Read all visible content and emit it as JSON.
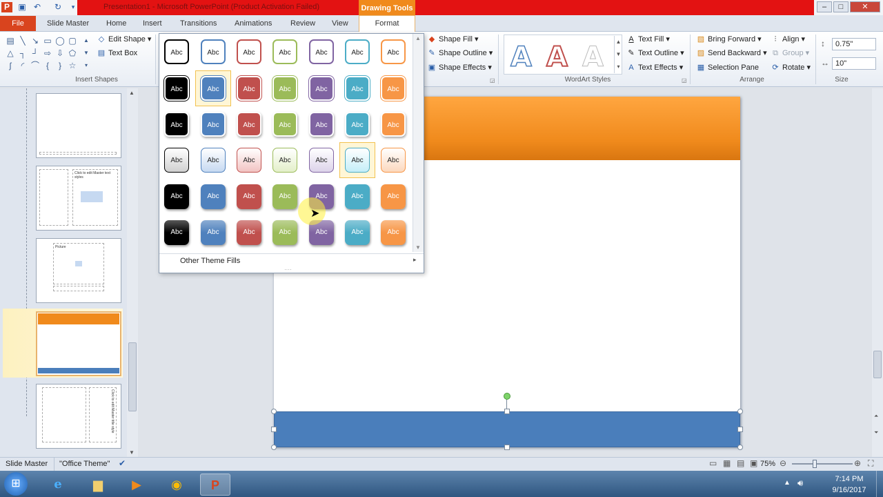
{
  "window": {
    "title": "Presentation1  -  Microsoft PowerPoint (Product Activation Failed)",
    "contextual_tab_group": "Drawing Tools"
  },
  "tabs": [
    {
      "label": "File"
    },
    {
      "label": "Slide Master"
    },
    {
      "label": "Home"
    },
    {
      "label": "Insert"
    },
    {
      "label": "Transitions"
    },
    {
      "label": "Animations"
    },
    {
      "label": "Review"
    },
    {
      "label": "View"
    },
    {
      "label": "Format"
    }
  ],
  "ribbon": {
    "insert_shapes": {
      "edit_shape": "Edit Shape",
      "text_box": "Text Box",
      "label": "Insert Shapes"
    },
    "shape_styles": {
      "shape_fill": "Shape Fill",
      "shape_outline": "Shape Outline",
      "shape_effects": "Shape Effects"
    },
    "wordart": {
      "text_fill": "Text Fill",
      "text_outline": "Text Outline",
      "text_effects": "Text Effects",
      "label": "WordArt Styles",
      "sample": "A"
    },
    "arrange": {
      "bring_forward": "Bring Forward",
      "send_backward": "Send Backward",
      "selection_pane": "Selection Pane",
      "align": "Align",
      "group": "Group",
      "rotate": "Rotate",
      "label": "Arrange"
    },
    "size": {
      "height": "0.75\"",
      "width": "10\"",
      "label": "Size"
    }
  },
  "gallery": {
    "swatch_text": "Abc",
    "other_theme_fills": "Other Theme Fills",
    "colors": [
      "#000000",
      "#4f81bd",
      "#c0504d",
      "#9bbb59",
      "#8064a2",
      "#4bacc6",
      "#f79646"
    ],
    "light_colors": [
      "#d0d0d0",
      "#c6d9f1",
      "#f2c3c2",
      "#e3efc9",
      "#ddd3ea",
      "#c4eef8",
      "#fcd8bd"
    ]
  },
  "statusbar": {
    "view": "Slide Master",
    "theme": "\"Office Theme\"",
    "zoom": "75%"
  },
  "taskbar": {
    "time": "7:14 PM",
    "date": "9/16/2017"
  },
  "thumbnails": [
    {
      "text": ""
    },
    {
      "text": "Click to edit Master text styles"
    },
    {
      "text": "Picture"
    },
    {
      "text": ""
    },
    {
      "text": "Click to edit Master title style"
    }
  ]
}
